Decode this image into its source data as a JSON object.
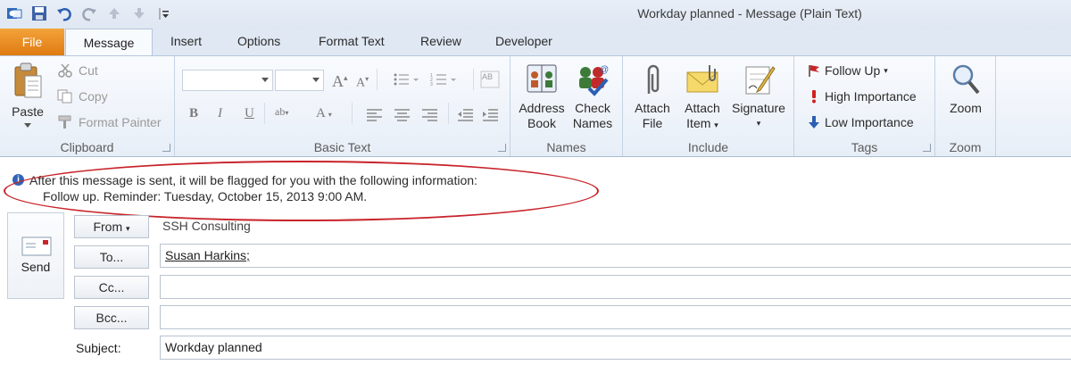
{
  "window": {
    "title": "Workday planned  -  Message (Plain Text)"
  },
  "qat": {
    "icons": [
      "outlook-icon",
      "save-icon",
      "undo-icon",
      "redo-icon",
      "up-arrow-icon",
      "down-arrow-icon",
      "customize-icon"
    ]
  },
  "tabs": {
    "file": "File",
    "message": "Message",
    "insert": "Insert",
    "options": "Options",
    "format_text": "Format Text",
    "review": "Review",
    "developer": "Developer"
  },
  "ribbon": {
    "clipboard": {
      "label": "Clipboard",
      "paste": "Paste",
      "cut": "Cut",
      "copy": "Copy",
      "format_painter": "Format Painter"
    },
    "basic_text": {
      "label": "Basic Text"
    },
    "names": {
      "label": "Names",
      "address_book_1": "Address",
      "address_book_2": "Book",
      "check_names_1": "Check",
      "check_names_2": "Names"
    },
    "include": {
      "label": "Include",
      "attach_file_1": "Attach",
      "attach_file_2": "File",
      "attach_item_1": "Attach",
      "attach_item_2": "Item",
      "signature": "Signature"
    },
    "tags": {
      "label": "Tags",
      "follow_up": "Follow Up",
      "high_importance": "High Importance",
      "low_importance": "Low Importance"
    },
    "zoom": {
      "label": "Zoom",
      "zoom": "Zoom"
    }
  },
  "info": {
    "line1": "After this message is sent, it will be flagged for you with the following information:",
    "line2": "Follow up.  Reminder: Tuesday, October 15, 2013 9:00 AM."
  },
  "compose": {
    "send": "Send",
    "from_button": "From",
    "from_value": "SSH Consulting",
    "to_button": "To...",
    "to_value": "Susan Harkins;",
    "cc_button": "Cc...",
    "cc_value": "",
    "bcc_button": "Bcc...",
    "bcc_value": "",
    "subject_label": "Subject:",
    "subject_value": "Workday planned"
  },
  "colors": {
    "accent_file_tab": "#e07b12",
    "annotation_oval": "#c8232a",
    "ribbon_bg": "#e7eef7"
  }
}
